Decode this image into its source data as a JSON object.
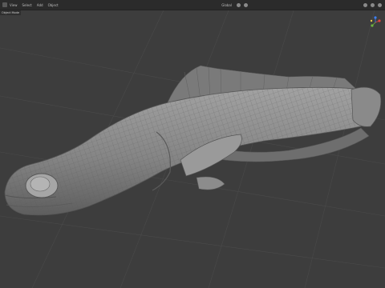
{
  "header": {
    "menus": [
      "View",
      "Select",
      "Add",
      "Object"
    ],
    "mode": "Object Mode",
    "transform": "Global"
  },
  "subbar": {
    "label": "Object Mode"
  },
  "gizmo": {
    "axes": [
      "X",
      "Y",
      "Z"
    ],
    "colors": {
      "x": "#e0443e",
      "y": "#6fb33e",
      "z": "#3f7ff0"
    }
  },
  "object": {
    "name": "fish-mesh",
    "color": "#8e8e8e"
  }
}
